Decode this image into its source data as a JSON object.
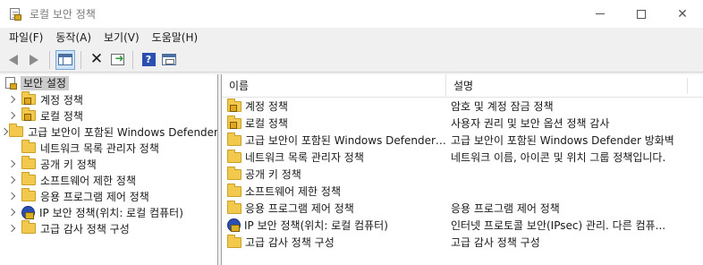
{
  "window": {
    "title": "로컬 보안 정책"
  },
  "menu": [
    "파일(F)",
    "동작(A)",
    "보기(V)",
    "도움말(H)"
  ],
  "tree": {
    "root": "보안 설정",
    "items": [
      {
        "label": "계정 정책",
        "icon": "folder-lock-icon"
      },
      {
        "label": "로컬 정책",
        "icon": "folder-lock-icon"
      },
      {
        "label": "고급 보안이 포함된 Windows Defender",
        "icon": "folder-icon"
      },
      {
        "label": "네트워크 목록 관리자 정책",
        "icon": "folder-icon"
      },
      {
        "label": "공개 키 정책",
        "icon": "folder-icon"
      },
      {
        "label": "소프트웨어 제한 정책",
        "icon": "folder-icon"
      },
      {
        "label": "응용 프로그램 제어 정책",
        "icon": "folder-icon"
      },
      {
        "label": "IP 보안 정책(위치: 로컬 컴퓨터)",
        "icon": "ip-security-icon"
      },
      {
        "label": "고급 감사 정책 구성",
        "icon": "folder-icon"
      }
    ]
  },
  "list": {
    "columns": {
      "name": "이름",
      "description": "설명"
    },
    "rows": [
      {
        "name": "계정 정책",
        "description": "암호 및 계정 잠금 정책",
        "icon": "folder-lock-icon"
      },
      {
        "name": "로컬 정책",
        "description": "사용자 권리 및 보안 옵션 정책 감사",
        "icon": "folder-lock-icon"
      },
      {
        "name": "고급 보안이 포함된 Windows Defender ...",
        "description": "고급 보안이 포함된 Windows Defender 방화벽",
        "icon": "folder-icon"
      },
      {
        "name": "네트워크 목록 관리자 정책",
        "description": "네트워크 이름, 아이콘 및 위치 그룹 정책입니다.",
        "icon": "folder-icon"
      },
      {
        "name": "공개 키 정책",
        "description": "",
        "icon": "folder-icon"
      },
      {
        "name": "소프트웨어 제한 정책",
        "description": "",
        "icon": "folder-icon"
      },
      {
        "name": "응용 프로그램 제어 정책",
        "description": "응용 프로그램 제어 정책",
        "icon": "folder-icon"
      },
      {
        "name": "IP 보안 정책(위치: 로컬 컴퓨터)",
        "description": "인터넷 프로토콜 보안(IPsec) 관리. 다른 컴퓨...",
        "icon": "ip-security-icon"
      },
      {
        "name": "고급 감사 정책 구성",
        "description": "고급 감사 정책 구성",
        "icon": "folder-icon"
      }
    ]
  }
}
